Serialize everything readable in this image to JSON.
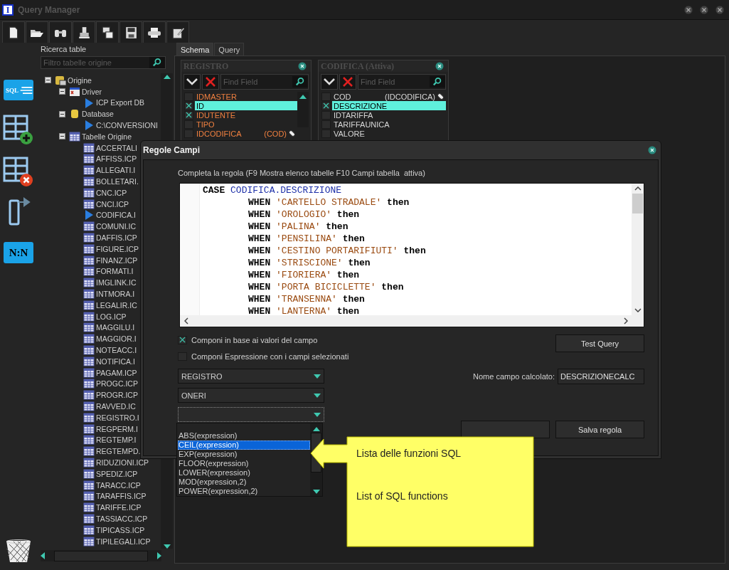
{
  "window": {
    "app_icon": "I",
    "title": "Query Manager"
  },
  "sidebar": [
    {
      "kind": "sql",
      "label": "SQL"
    },
    {
      "kind": "add-table"
    },
    {
      "kind": "remove-table"
    },
    {
      "kind": "export"
    },
    {
      "kind": "relation",
      "label": "N:N"
    }
  ],
  "tree_panel": {
    "label": "Ricerca table",
    "filter_placeholder": "Filtro tabelle origine",
    "tree": [
      {
        "label": "Origine",
        "kind": "root",
        "expanded": true,
        "children": [
          {
            "label": "Driver",
            "kind": "driver",
            "expanded": true,
            "children": [
              {
                "label": "ICP Export DB",
                "kind": "connection"
              }
            ]
          },
          {
            "label": "Database",
            "kind": "database",
            "expanded": true,
            "children": [
              {
                "label": "C:\\CONVERSIONI",
                "kind": "connection"
              }
            ]
          },
          {
            "label": "Tabelle Origine",
            "kind": "tables",
            "expanded": true,
            "children": [
              {
                "label": "ACCERTALI",
                "kind": "table"
              },
              {
                "label": "AFFISS.ICP",
                "kind": "table"
              },
              {
                "label": "ALLEGATI.I",
                "kind": "table"
              },
              {
                "label": "BOLLETARI.",
                "kind": "table"
              },
              {
                "label": "CNC.ICP",
                "kind": "table"
              },
              {
                "label": "CNCI.ICP",
                "kind": "table"
              },
              {
                "label": "CODIFICA.I",
                "kind": "connection"
              },
              {
                "label": "COMUNI.IC",
                "kind": "table"
              },
              {
                "label": "DAFFIS.ICP",
                "kind": "table"
              },
              {
                "label": "FIGURE.ICP",
                "kind": "table"
              },
              {
                "label": "FINANZ.ICP",
                "kind": "table"
              },
              {
                "label": "FORMATI.I",
                "kind": "table"
              },
              {
                "label": "IMGLINK.IC",
                "kind": "table"
              },
              {
                "label": "INTMORA.I",
                "kind": "table"
              },
              {
                "label": "LEGALIR.IC",
                "kind": "table"
              },
              {
                "label": "LOG.ICP",
                "kind": "table"
              },
              {
                "label": "MAGGILU.I",
                "kind": "table"
              },
              {
                "label": "MAGGIOR.I",
                "kind": "table"
              },
              {
                "label": "NOTEACC.I",
                "kind": "table"
              },
              {
                "label": "NOTIFICA.I",
                "kind": "table"
              },
              {
                "label": "PAGAM.ICP",
                "kind": "table"
              },
              {
                "label": "PROGC.ICP",
                "kind": "table"
              },
              {
                "label": "PROGR.ICP",
                "kind": "table"
              },
              {
                "label": "RAVVED.IC",
                "kind": "table"
              },
              {
                "label": "REGISTRO.I",
                "kind": "table"
              },
              {
                "label": "REGPERM.I",
                "kind": "table"
              },
              {
                "label": "REGTEMP.I",
                "kind": "table"
              },
              {
                "label": "REGTEMPD.",
                "kind": "table"
              },
              {
                "label": "RIDUZIONI.ICP",
                "kind": "table"
              },
              {
                "label": "SPEDIZ.ICP",
                "kind": "table"
              },
              {
                "label": "TARACC.ICP",
                "kind": "table"
              },
              {
                "label": "TARAFFIS.ICP",
                "kind": "table"
              },
              {
                "label": "TARIFFE.ICP",
                "kind": "table"
              },
              {
                "label": "TASSIACC.ICP",
                "kind": "table"
              },
              {
                "label": "TIPICASS.ICP",
                "kind": "table"
              },
              {
                "label": "TIPILEGALI.ICP",
                "kind": "table"
              }
            ]
          }
        ]
      }
    ]
  },
  "tabs": [
    {
      "label": "Schema",
      "selected": true
    },
    {
      "label": "Query",
      "selected": false
    }
  ],
  "tables": [
    {
      "title": "REGISTRO",
      "color": "#f08040",
      "search_placeholder": "Find Field",
      "fields": [
        {
          "name": "IDMASTER",
          "checked": false,
          "selected": false
        },
        {
          "name": "ID",
          "checked": true,
          "selected": true
        },
        {
          "name": "IDUTENTE",
          "checked": true,
          "selected": false
        },
        {
          "name": "TIPO",
          "checked": false,
          "selected": false
        },
        {
          "name": "IDCODIFICA",
          "link": "(COD)",
          "checked": false,
          "selected": false
        }
      ]
    },
    {
      "title": "CODIFICA (Attiva)",
      "color": "#d8d8d8",
      "search_placeholder": "Find Field",
      "fields": [
        {
          "name": "COD",
          "link": "(IDCODIFICA)",
          "checked": false,
          "selected": false
        },
        {
          "name": "DESCRIZIONE",
          "checked": true,
          "selected": true
        },
        {
          "name": "IDTARIFFA",
          "checked": false,
          "selected": false
        },
        {
          "name": "TARIFFAUNICA",
          "checked": false,
          "selected": false
        },
        {
          "name": "VALORE",
          "checked": false,
          "selected": false
        }
      ]
    }
  ],
  "dialog": {
    "title": "Regole Campi",
    "instruction": "Completa la regola (F9 Mostra elenco tabelle F10 Campi tabella  attiva)",
    "code": [
      {
        "tokens": [
          {
            "kind": "keyword",
            "text": "CASE"
          },
          {
            "kind": "field",
            "text": "CODIFICA.DESCRIZIONE"
          }
        ],
        "children": [
          {
            "tokens": [
              {
                "kind": "keyword",
                "text": "WHEN"
              },
              {
                "kind": "string",
                "text": "'CARTELLO STRADALE'"
              },
              {
                "kind": "keyword",
                "text": "then"
              }
            ]
          },
          {
            "tokens": [
              {
                "kind": "keyword",
                "text": "WHEN"
              },
              {
                "kind": "string",
                "text": "'OROLOGIO'"
              },
              {
                "kind": "keyword",
                "text": "then"
              }
            ]
          },
          {
            "tokens": [
              {
                "kind": "keyword",
                "text": "WHEN"
              },
              {
                "kind": "string",
                "text": "'PALINA'"
              },
              {
                "kind": "keyword",
                "text": "then"
              }
            ]
          },
          {
            "tokens": [
              {
                "kind": "keyword",
                "text": "WHEN"
              },
              {
                "kind": "string",
                "text": "'PENSILINA'"
              },
              {
                "kind": "keyword",
                "text": "then"
              }
            ]
          },
          {
            "tokens": [
              {
                "kind": "keyword",
                "text": "WHEN"
              },
              {
                "kind": "string",
                "text": "'CESTINO PORTARIFIUTI'"
              },
              {
                "kind": "keyword",
                "text": "then"
              }
            ]
          },
          {
            "tokens": [
              {
                "kind": "keyword",
                "text": "WHEN"
              },
              {
                "kind": "string",
                "text": "'STRISCIONE'"
              },
              {
                "kind": "keyword",
                "text": "then"
              }
            ]
          },
          {
            "tokens": [
              {
                "kind": "keyword",
                "text": "WHEN"
              },
              {
                "kind": "string",
                "text": "'FIORIERA'"
              },
              {
                "kind": "keyword",
                "text": "then"
              }
            ]
          },
          {
            "tokens": [
              {
                "kind": "keyword",
                "text": "WHEN"
              },
              {
                "kind": "string",
                "text": "'PORTA BICICLETTE'"
              },
              {
                "kind": "keyword",
                "text": "then"
              }
            ]
          },
          {
            "tokens": [
              {
                "kind": "keyword",
                "text": "WHEN"
              },
              {
                "kind": "string",
                "text": "'TRANSENNA'"
              },
              {
                "kind": "keyword",
                "text": "then"
              }
            ]
          },
          {
            "tokens": [
              {
                "kind": "keyword",
                "text": "WHEN"
              },
              {
                "kind": "string",
                "text": "'LANTERNA'"
              },
              {
                "kind": "keyword",
                "text": "then"
              }
            ]
          }
        ]
      }
    ],
    "options": [
      {
        "label": "Componi in base ai valori del campo",
        "checked": true
      },
      {
        "label": "Componi Espressione con i campi selezionati",
        "checked": false
      }
    ],
    "selects": [
      "REGISTRO",
      "ONERI"
    ],
    "function_select": {
      "open": true,
      "items": [
        {
          "label": "ABS(expression)",
          "selected": false
        },
        {
          "label": "CEIL(expression)",
          "selected": true
        },
        {
          "label": "EXP(expression)",
          "selected": false
        },
        {
          "label": "FLOOR(expression)",
          "selected": false
        },
        {
          "label": "LOWER(expression)",
          "selected": false
        },
        {
          "label": "MOD(expression,2)",
          "selected": false
        },
        {
          "label": "POWER(expression,2)",
          "selected": false
        }
      ]
    },
    "test_button": "Test Query",
    "calc_label": "Nome campo calcolato:",
    "calc_value": "DESCRIZIONECALC",
    "save_button": "Salva regola"
  },
  "callout": {
    "lines": [
      "Lista delle funzioni SQL",
      "List of SQL functions"
    ]
  }
}
